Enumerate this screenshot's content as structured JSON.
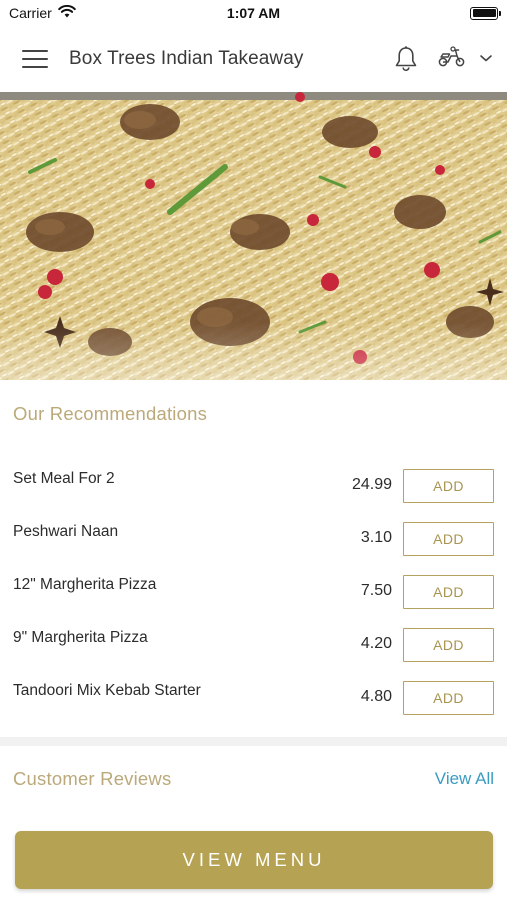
{
  "status_bar": {
    "carrier": "Carrier",
    "time": "1:07 AM",
    "battery_level": 1.0
  },
  "nav": {
    "title": "Box Trees Indian Takeaway",
    "icons": [
      "menu-icon",
      "bell-icon",
      "scooter-icon",
      "chevron-down-icon"
    ]
  },
  "hero": {
    "image": "biryani rice dish"
  },
  "recommendations": {
    "title": "Our Recommendations",
    "items": [
      {
        "name": "Set Meal For 2",
        "price": "24.99",
        "action": "ADD"
      },
      {
        "name": "Peshwari Naan",
        "price": "3.10",
        "action": "ADD"
      },
      {
        "name": "12\" Margherita Pizza",
        "price": "7.50",
        "action": "ADD"
      },
      {
        "name": "9\" Margherita Pizza",
        "price": "4.20",
        "action": "ADD"
      },
      {
        "name": "Tandoori Mix Kebab Starter",
        "price": "4.80",
        "action": "ADD"
      }
    ]
  },
  "reviews": {
    "title": "Customer Reviews",
    "view_all": "View All"
  },
  "footer": {
    "view_menu": "VIEW MENU"
  },
  "colors": {
    "accent": "#b5a253",
    "section_title": "#bba97a",
    "link": "#3a9cc2"
  }
}
